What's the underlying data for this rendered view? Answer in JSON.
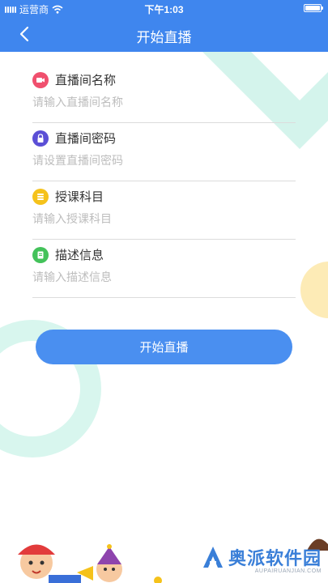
{
  "status_bar": {
    "carrier": "运营商",
    "time": "下午1:03"
  },
  "nav": {
    "title": "开始直播"
  },
  "form": {
    "fields": [
      {
        "label": "直播间名称",
        "placeholder": "请输入直播间名称",
        "icon": "video-icon",
        "color": "#f0506e"
      },
      {
        "label": "直播间密码",
        "placeholder": "请设置直播间密码",
        "icon": "lock-icon",
        "color": "#5b4fd6"
      },
      {
        "label": "授课科目",
        "placeholder": "请输入授课科目",
        "icon": "subject-list-icon",
        "color": "#f5c21b"
      },
      {
        "label": "描述信息",
        "placeholder": "请输入描述信息",
        "icon": "document-icon",
        "color": "#43c25a"
      }
    ]
  },
  "button": {
    "label": "开始直播"
  },
  "watermark": {
    "name": "奥派软件园",
    "domain": "AUPAIRUANJIAN.COM"
  },
  "colors": {
    "primary": "#3f86ee",
    "button": "#4a8ff0",
    "mint": "#c9f1e8",
    "yellow": "#fde9b0"
  }
}
